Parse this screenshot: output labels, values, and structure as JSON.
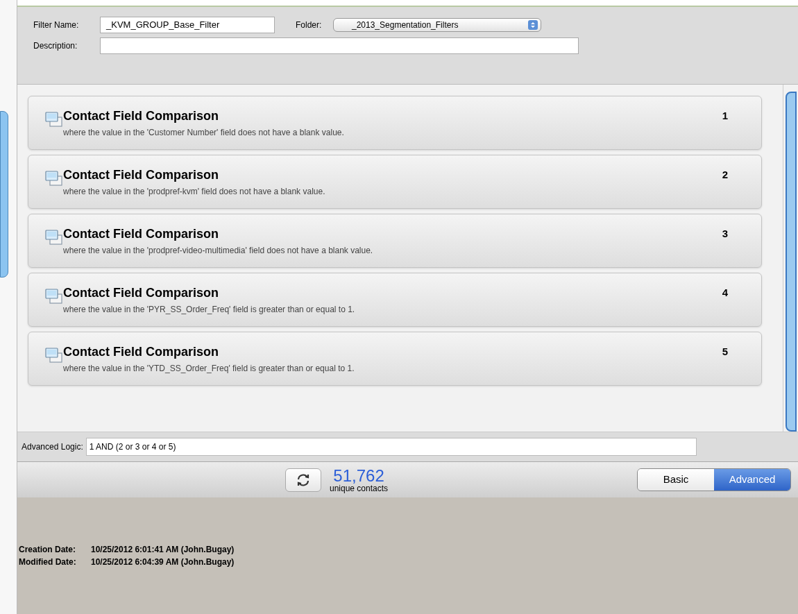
{
  "header": {
    "filter_name": {
      "label": "Filter Name:",
      "value": "_KVM_GROUP_Base_Filter"
    },
    "folder": {
      "label": "Folder:",
      "value": "_2013_Segmentation_Filters"
    },
    "description": {
      "label": "Description:"
    }
  },
  "criteria": [
    {
      "title": "Contact Field Comparison",
      "detail": "where the value in the 'Customer Number' field does not have a blank value.",
      "number": "1"
    },
    {
      "title": "Contact Field Comparison",
      "detail": "where the value in the 'prodpref-kvm' field does not have a blank value.",
      "number": "2"
    },
    {
      "title": "Contact Field Comparison",
      "detail": "where the value in the 'prodpref-video-multimedia' field does not have a blank value.",
      "number": "3"
    },
    {
      "title": "Contact Field Comparison",
      "detail": "where the value in the 'PYR_SS_Order_Freq' field is greater than or equal to 1.",
      "number": "4"
    },
    {
      "title": "Contact Field Comparison",
      "detail": "where the value in the 'YTD_SS_Order_Freq' field is greater than or equal to 1.",
      "number": "5"
    }
  ],
  "advanced_logic": {
    "label": "Advanced Logic:",
    "value": "1 AND (2 or 3 or 4 or 5)"
  },
  "count": {
    "value": "51,762",
    "label": "unique contacts"
  },
  "modes": [
    {
      "label": "Basic",
      "selected": false
    },
    {
      "label": "Advanced",
      "selected": true
    }
  ],
  "footer": [
    {
      "label": "Creation Date:",
      "value": "10/25/2012 6:01:41 AM (John.Bugay)"
    },
    {
      "label": "Modified Date:",
      "value": "10/25/2012 6:04:39 AM (John.Bugay)"
    }
  ]
}
